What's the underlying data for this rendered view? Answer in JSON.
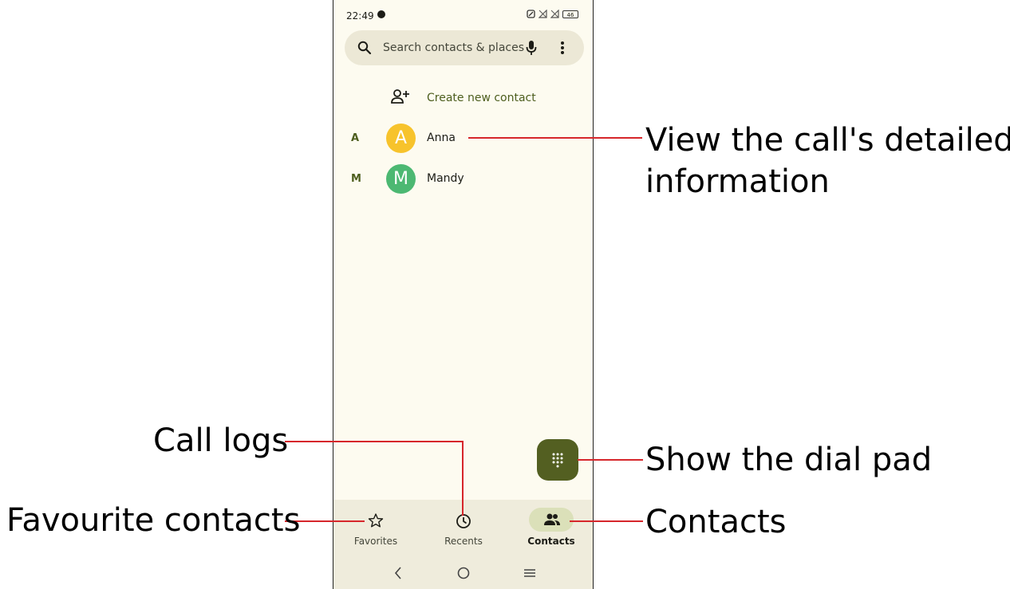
{
  "status_bar": {
    "time": "22:49",
    "battery": "46"
  },
  "search": {
    "placeholder": "Search contacts & places"
  },
  "create_contact": {
    "label": "Create new contact"
  },
  "contacts": [
    {
      "section": "A",
      "initial": "A",
      "name": "Anna",
      "color": "#f7c32c"
    },
    {
      "section": "M",
      "initial": "M",
      "name": "Mandy",
      "color": "#4cb872"
    }
  ],
  "bottom_nav": {
    "favorites": "Favorites",
    "recents": "Recents",
    "contacts": "Contacts"
  },
  "annotations": {
    "view_details": "View the call's detailed information",
    "view_details_line1": "View the call's detailed",
    "view_details_line2": "information",
    "call_logs": "Call logs",
    "show_dial_pad": "Show the dial pad",
    "favourite_contacts": "Favourite contacts",
    "contacts": "Contacts"
  },
  "colors": {
    "accent": "#535f21",
    "annotation_line": "#d6262b",
    "background": "#fdfbf0"
  }
}
